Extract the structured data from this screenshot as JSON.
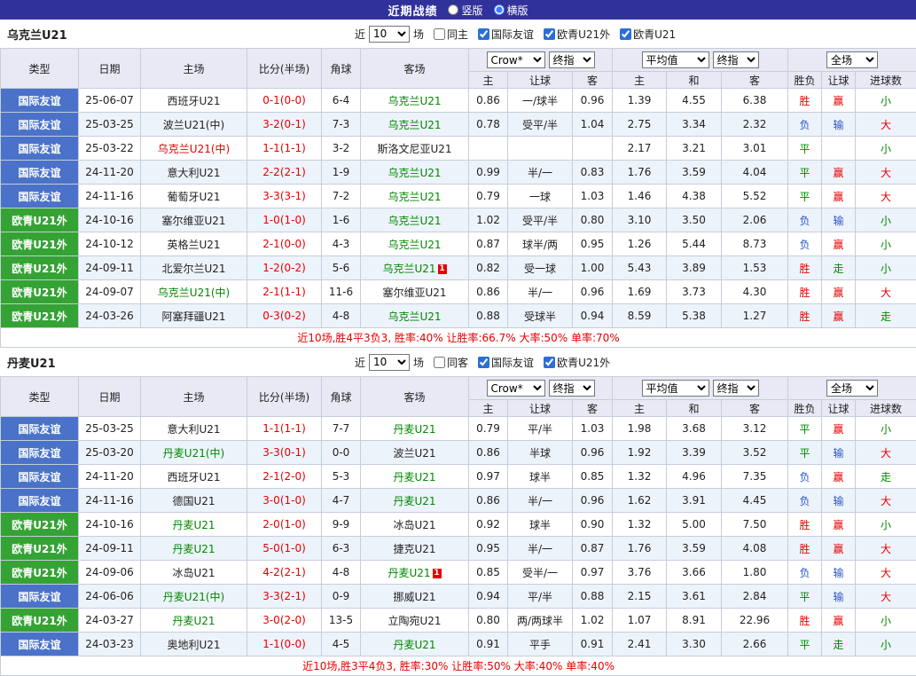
{
  "topbar": {
    "title": "近期战绩",
    "radio_vertical": "竖版",
    "radio_horizontal": "横版",
    "vertical_checked": false,
    "horizontal_checked": true
  },
  "colors": {
    "red": "#e60000",
    "green": "#008800",
    "blue": "#2b55c8",
    "black": "#222222",
    "type_blue": "#4a72c8",
    "type_green": "#34a334",
    "topbar_bg": "#31319c"
  },
  "sections": [
    {
      "team": "乌克兰U21",
      "filter": {
        "near_label": "近",
        "count": "10",
        "games_label": "场",
        "checkboxes": [
          {
            "label": "同主",
            "checked": false
          },
          {
            "label": "国际友谊",
            "checked": true
          },
          {
            "label": "欧青U21外",
            "checked": true
          },
          {
            "label": "欧青U21",
            "checked": true
          }
        ]
      },
      "dropdowns": {
        "odds_source": "Crow*",
        "odds_time": "终指",
        "avg_source": "平均值",
        "avg_time": "终指",
        "scope": "全场"
      },
      "columns": [
        "类型",
        "日期",
        "主场",
        "比分(半场)",
        "角球",
        "客场",
        "主",
        "让球",
        "客",
        "主",
        "和",
        "客",
        "胜负",
        "让球",
        "进球数"
      ],
      "rows": [
        {
          "type": "国际友谊",
          "type_color": "blue",
          "date": "25-06-07",
          "home": "西班牙U21",
          "home_color": "black",
          "score": "0-1(0-0)",
          "corner": "6-4",
          "away": "乌克兰U21",
          "away_color": "green",
          "odds_home": "0.86",
          "handicap": "一/球半",
          "odds_away": "0.96",
          "avg_home": "1.39",
          "avg_draw": "4.55",
          "avg_away": "6.38",
          "result": "胜",
          "result_color": "red",
          "handicap_result": "赢",
          "handicap_result_color": "red",
          "goals_result": "小",
          "goals_result_color": "green"
        },
        {
          "type": "国际友谊",
          "type_color": "blue",
          "date": "25-03-25",
          "home": "波兰U21(中)",
          "home_color": "black",
          "score": "3-2(0-1)",
          "corner": "7-3",
          "away": "乌克兰U21",
          "away_color": "green",
          "odds_home": "0.78",
          "handicap": "受平/半",
          "odds_away": "1.04",
          "avg_home": "2.75",
          "avg_draw": "3.34",
          "avg_away": "2.32",
          "result": "负",
          "result_color": "blue",
          "handicap_result": "输",
          "handicap_result_color": "blue",
          "goals_result": "大",
          "goals_result_color": "red"
        },
        {
          "type": "国际友谊",
          "type_color": "blue",
          "date": "25-03-22",
          "home": "乌克兰U21(中)",
          "home_color": "red",
          "score": "1-1(1-1)",
          "corner": "3-2",
          "away": "斯洛文尼亚U21",
          "away_color": "black",
          "odds_home": "",
          "handicap": "",
          "odds_away": "",
          "avg_home": "2.17",
          "avg_draw": "3.21",
          "avg_away": "3.01",
          "result": "平",
          "result_color": "green",
          "handicap_result": "",
          "handicap_result_color": "black",
          "goals_result": "小",
          "goals_result_color": "green"
        },
        {
          "type": "国际友谊",
          "type_color": "blue",
          "date": "24-11-20",
          "home": "意大利U21",
          "home_color": "black",
          "score": "2-2(2-1)",
          "corner": "1-9",
          "away": "乌克兰U21",
          "away_color": "green",
          "odds_home": "0.99",
          "handicap": "半/一",
          "odds_away": "0.83",
          "avg_home": "1.76",
          "avg_draw": "3.59",
          "avg_away": "4.04",
          "result": "平",
          "result_color": "green",
          "handicap_result": "赢",
          "handicap_result_color": "red",
          "goals_result": "大",
          "goals_result_color": "red"
        },
        {
          "type": "国际友谊",
          "type_color": "blue",
          "date": "24-11-16",
          "home": "葡萄牙U21",
          "home_color": "black",
          "score": "3-3(3-1)",
          "corner": "7-2",
          "away": "乌克兰U21",
          "away_color": "green",
          "odds_home": "0.79",
          "handicap": "一球",
          "odds_away": "1.03",
          "avg_home": "1.46",
          "avg_draw": "4.38",
          "avg_away": "5.52",
          "result": "平",
          "result_color": "green",
          "handicap_result": "赢",
          "handicap_result_color": "red",
          "goals_result": "大",
          "goals_result_color": "red"
        },
        {
          "type": "欧青U21外",
          "type_color": "green",
          "date": "24-10-16",
          "home": "塞尔维亚U21",
          "home_color": "black",
          "score": "1-0(1-0)",
          "corner": "1-6",
          "away": "乌克兰U21",
          "away_color": "green",
          "odds_home": "1.02",
          "handicap": "受平/半",
          "odds_away": "0.80",
          "avg_home": "3.10",
          "avg_draw": "3.50",
          "avg_away": "2.06",
          "result": "负",
          "result_color": "blue",
          "handicap_result": "输",
          "handicap_result_color": "blue",
          "goals_result": "小",
          "goals_result_color": "green"
        },
        {
          "type": "欧青U21外",
          "type_color": "green",
          "date": "24-10-12",
          "home": "英格兰U21",
          "home_color": "black",
          "score": "2-1(0-0)",
          "corner": "4-3",
          "away": "乌克兰U21",
          "away_color": "green",
          "odds_home": "0.87",
          "handicap": "球半/两",
          "odds_away": "0.95",
          "avg_home": "1.26",
          "avg_draw": "5.44",
          "avg_away": "8.73",
          "result": "负",
          "result_color": "blue",
          "handicap_result": "赢",
          "handicap_result_color": "red",
          "goals_result": "小",
          "goals_result_color": "green"
        },
        {
          "type": "欧青U21外",
          "type_color": "green",
          "date": "24-09-11",
          "home": "北爱尔兰U21",
          "home_color": "black",
          "score": "1-2(0-2)",
          "corner": "5-6",
          "away": "乌克兰U21",
          "away_color": "green",
          "away_redcard": "1",
          "odds_home": "0.82",
          "handicap": "受一球",
          "odds_away": "1.00",
          "avg_home": "5.43",
          "avg_draw": "3.89",
          "avg_away": "1.53",
          "result": "胜",
          "result_color": "red",
          "handicap_result": "走",
          "handicap_result_color": "green",
          "goals_result": "小",
          "goals_result_color": "green"
        },
        {
          "type": "欧青U21外",
          "type_color": "green",
          "date": "24-09-07",
          "home": "乌克兰U21(中)",
          "home_color": "green",
          "score": "2-1(1-1)",
          "corner": "11-6",
          "away": "塞尔维亚U21",
          "away_color": "black",
          "odds_home": "0.86",
          "handicap": "半/一",
          "odds_away": "0.96",
          "avg_home": "1.69",
          "avg_draw": "3.73",
          "avg_away": "4.30",
          "result": "胜",
          "result_color": "red",
          "handicap_result": "赢",
          "handicap_result_color": "red",
          "goals_result": "大",
          "goals_result_color": "red"
        },
        {
          "type": "欧青U21外",
          "type_color": "green",
          "date": "24-03-26",
          "home": "阿塞拜疆U21",
          "home_color": "black",
          "score": "0-3(0-2)",
          "corner": "4-8",
          "away": "乌克兰U21",
          "away_color": "green",
          "odds_home": "0.88",
          "handicap": "受球半",
          "odds_away": "0.94",
          "avg_home": "8.59",
          "avg_draw": "5.38",
          "avg_away": "1.27",
          "result": "胜",
          "result_color": "red",
          "handicap_result": "赢",
          "handicap_result_color": "red",
          "goals_result": "走",
          "goals_result_color": "green"
        }
      ],
      "summary": "近10场,胜4平3负3, 胜率:40% 让胜率:66.7% 大率:50% 单率:70%"
    },
    {
      "team": "丹麦U21",
      "filter": {
        "near_label": "近",
        "count": "10",
        "games_label": "场",
        "checkboxes": [
          {
            "label": "同客",
            "checked": false
          },
          {
            "label": "国际友谊",
            "checked": true
          },
          {
            "label": "欧青U21外",
            "checked": true
          }
        ]
      },
      "dropdowns": {
        "odds_source": "Crow*",
        "odds_time": "终指",
        "avg_source": "平均值",
        "avg_time": "终指",
        "scope": "全场"
      },
      "columns": [
        "类型",
        "日期",
        "主场",
        "比分(半场)",
        "角球",
        "客场",
        "主",
        "让球",
        "客",
        "主",
        "和",
        "客",
        "胜负",
        "让球",
        "进球数"
      ],
      "rows": [
        {
          "type": "国际友谊",
          "type_color": "blue",
          "date": "25-03-25",
          "home": "意大利U21",
          "home_color": "black",
          "score": "1-1(1-1)",
          "corner": "7-7",
          "away": "丹麦U21",
          "away_color": "green",
          "odds_home": "0.79",
          "handicap": "平/半",
          "odds_away": "1.03",
          "avg_home": "1.98",
          "avg_draw": "3.68",
          "avg_away": "3.12",
          "result": "平",
          "result_color": "green",
          "handicap_result": "赢",
          "handicap_result_color": "red",
          "goals_result": "小",
          "goals_result_color": "green"
        },
        {
          "type": "国际友谊",
          "type_color": "blue",
          "date": "25-03-20",
          "home": "丹麦U21(中)",
          "home_color": "green",
          "score": "3-3(0-1)",
          "corner": "0-0",
          "away": "波兰U21",
          "away_color": "black",
          "odds_home": "0.86",
          "handicap": "半球",
          "odds_away": "0.96",
          "avg_home": "1.92",
          "avg_draw": "3.39",
          "avg_away": "3.52",
          "result": "平",
          "result_color": "green",
          "handicap_result": "输",
          "handicap_result_color": "blue",
          "goals_result": "大",
          "goals_result_color": "red"
        },
        {
          "type": "国际友谊",
          "type_color": "blue",
          "date": "24-11-20",
          "home": "西班牙U21",
          "home_color": "black",
          "score": "2-1(2-0)",
          "corner": "5-3",
          "away": "丹麦U21",
          "away_color": "green",
          "odds_home": "0.97",
          "handicap": "球半",
          "odds_away": "0.85",
          "avg_home": "1.32",
          "avg_draw": "4.96",
          "avg_away": "7.35",
          "result": "负",
          "result_color": "blue",
          "handicap_result": "赢",
          "handicap_result_color": "red",
          "goals_result": "走",
          "goals_result_color": "green"
        },
        {
          "type": "国际友谊",
          "type_color": "blue",
          "date": "24-11-16",
          "home": "德国U21",
          "home_color": "black",
          "score": "3-0(1-0)",
          "corner": "4-7",
          "away": "丹麦U21",
          "away_color": "green",
          "odds_home": "0.86",
          "handicap": "半/一",
          "odds_away": "0.96",
          "avg_home": "1.62",
          "avg_draw": "3.91",
          "avg_away": "4.45",
          "result": "负",
          "result_color": "blue",
          "handicap_result": "输",
          "handicap_result_color": "blue",
          "goals_result": "大",
          "goals_result_color": "red"
        },
        {
          "type": "欧青U21外",
          "type_color": "green",
          "date": "24-10-16",
          "home": "丹麦U21",
          "home_color": "green",
          "score": "2-0(1-0)",
          "corner": "9-9",
          "away": "冰岛U21",
          "away_color": "black",
          "odds_home": "0.92",
          "handicap": "球半",
          "odds_away": "0.90",
          "avg_home": "1.32",
          "avg_draw": "5.00",
          "avg_away": "7.50",
          "result": "胜",
          "result_color": "red",
          "handicap_result": "赢",
          "handicap_result_color": "red",
          "goals_result": "小",
          "goals_result_color": "green"
        },
        {
          "type": "欧青U21外",
          "type_color": "green",
          "date": "24-09-11",
          "home": "丹麦U21",
          "home_color": "green",
          "score": "5-0(1-0)",
          "corner": "6-3",
          "away": "捷克U21",
          "away_color": "black",
          "odds_home": "0.95",
          "handicap": "半/一",
          "odds_away": "0.87",
          "avg_home": "1.76",
          "avg_draw": "3.59",
          "avg_away": "4.08",
          "result": "胜",
          "result_color": "red",
          "handicap_result": "赢",
          "handicap_result_color": "red",
          "goals_result": "大",
          "goals_result_color": "red"
        },
        {
          "type": "欧青U21外",
          "type_color": "green",
          "date": "24-09-06",
          "home": "冰岛U21",
          "home_color": "black",
          "score": "4-2(2-1)",
          "corner": "4-8",
          "away": "丹麦U21",
          "away_color": "green",
          "away_redcard": "1",
          "odds_home": "0.85",
          "handicap": "受半/一",
          "odds_away": "0.97",
          "avg_home": "3.76",
          "avg_draw": "3.66",
          "avg_away": "1.80",
          "result": "负",
          "result_color": "blue",
          "handicap_result": "输",
          "handicap_result_color": "blue",
          "goals_result": "大",
          "goals_result_color": "red"
        },
        {
          "type": "国际友谊",
          "type_color": "blue",
          "date": "24-06-06",
          "home": "丹麦U21(中)",
          "home_color": "green",
          "score": "3-3(2-1)",
          "corner": "0-9",
          "away": "挪威U21",
          "away_color": "black",
          "odds_home": "0.94",
          "handicap": "平/半",
          "odds_away": "0.88",
          "avg_home": "2.15",
          "avg_draw": "3.61",
          "avg_away": "2.84",
          "result": "平",
          "result_color": "green",
          "handicap_result": "输",
          "handicap_result_color": "blue",
          "goals_result": "大",
          "goals_result_color": "red"
        },
        {
          "type": "欧青U21外",
          "type_color": "green",
          "date": "24-03-27",
          "home": "丹麦U21",
          "home_color": "green",
          "score": "3-0(2-0)",
          "corner": "13-5",
          "away": "立陶宛U21",
          "away_color": "black",
          "odds_home": "0.80",
          "handicap": "两/两球半",
          "odds_away": "1.02",
          "avg_home": "1.07",
          "avg_draw": "8.91",
          "avg_away": "22.96",
          "result": "胜",
          "result_color": "red",
          "handicap_result": "赢",
          "handicap_result_color": "red",
          "goals_result": "小",
          "goals_result_color": "green"
        },
        {
          "type": "国际友谊",
          "type_color": "blue",
          "date": "24-03-23",
          "home": "奥地利U21",
          "home_color": "black",
          "score": "1-1(0-0)",
          "corner": "4-5",
          "away": "丹麦U21",
          "away_color": "green",
          "odds_home": "0.91",
          "handicap": "平手",
          "odds_away": "0.91",
          "avg_home": "2.41",
          "avg_draw": "3.30",
          "avg_away": "2.66",
          "result": "平",
          "result_color": "green",
          "handicap_result": "走",
          "handicap_result_color": "green",
          "goals_result": "小",
          "goals_result_color": "green"
        }
      ],
      "summary": "近10场,胜3平4负3, 胜率:30% 让胜率:50% 大率:40% 单率:40%"
    }
  ]
}
